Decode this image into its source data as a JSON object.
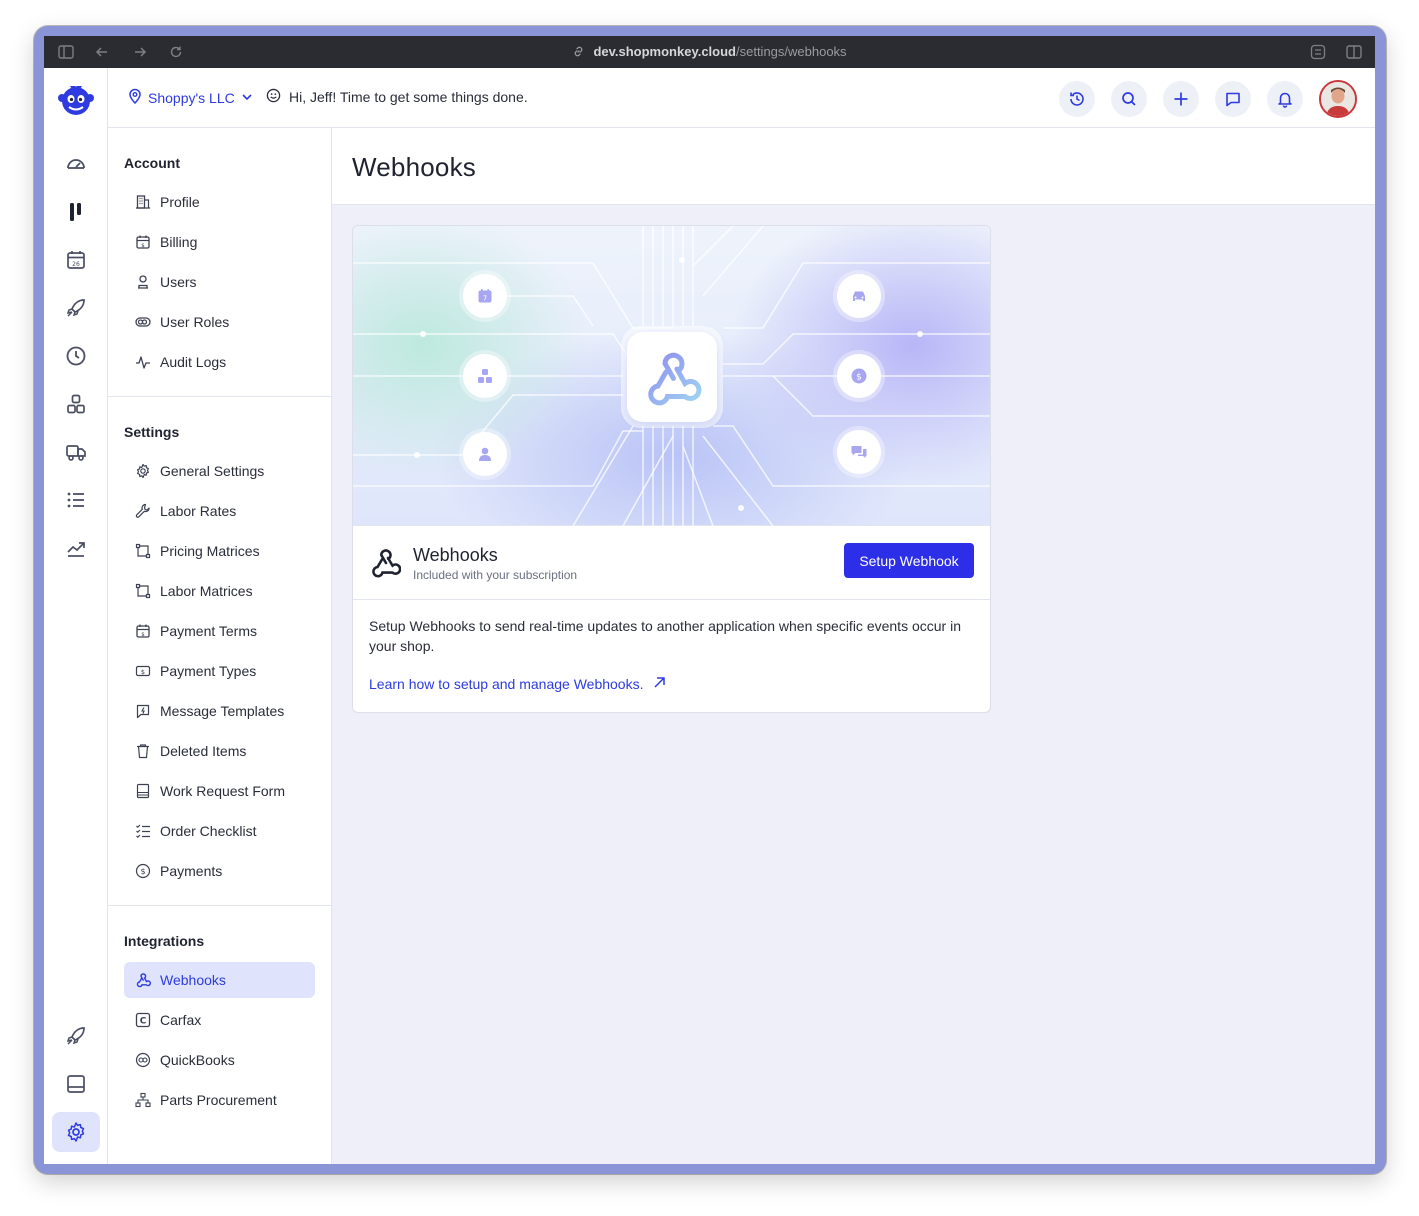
{
  "browser": {
    "url_domain": "dev.shopmonkey.cloud",
    "url_path": "/settings/webhooks"
  },
  "header": {
    "shop_name": "Shoppy's LLC",
    "greeting": "Hi, Jeff! Time to get some things done."
  },
  "settings_nav": {
    "account_title": "Account",
    "account_items": [
      "Profile",
      "Billing",
      "Users",
      "User Roles",
      "Audit Logs"
    ],
    "settings_title": "Settings",
    "settings_items": [
      "General Settings",
      "Labor Rates",
      "Pricing Matrices",
      "Labor Matrices",
      "Payment Terms",
      "Payment Types",
      "Message Templates",
      "Deleted Items",
      "Work Request Form",
      "Order Checklist",
      "Payments"
    ],
    "integrations_title": "Integrations",
    "integrations_items": [
      "Webhooks",
      "Carfax",
      "QuickBooks",
      "Parts Procurement"
    ],
    "active_item": "Webhooks"
  },
  "main": {
    "page_title": "Webhooks",
    "card": {
      "name": "Webhooks",
      "subtitle": "Included with your subscription",
      "button_label": "Setup Webhook",
      "description": "Setup Webhooks to send real-time updates to another application when specific events occur in your shop.",
      "link_text": "Learn how to setup and manage Webhooks."
    }
  },
  "colors": {
    "accent": "#2d3be0",
    "button": "#2d2ee8",
    "main_bg": "#eeeff8",
    "active_bg": "#dfe3fb"
  }
}
